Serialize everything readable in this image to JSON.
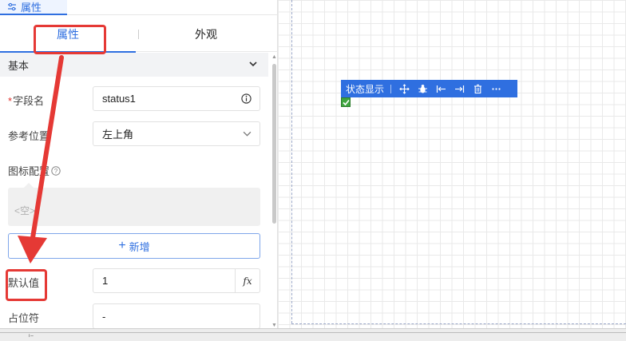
{
  "panel": {
    "tab_label": "属性",
    "tab_icon": "sliders-icon",
    "subtabs": {
      "active": "属性",
      "other": "外观"
    },
    "group": {
      "title": "基本",
      "icon": "chevron-down-icon"
    },
    "fields": {
      "field_name": {
        "required_mark": "*",
        "label": "字段名",
        "value": "status1",
        "icon": "info-icon"
      },
      "ref_position": {
        "label": "参考位置",
        "value": "左上角",
        "icon": "chevron-down-icon"
      },
      "icon_config": {
        "label": "图标配置",
        "icon": "help-circle-icon",
        "empty_text": "<空>"
      },
      "add_button": {
        "label": "新增",
        "icon": "plus-icon"
      },
      "default_value": {
        "label": "默认值",
        "value": "1",
        "fx_label": "fx"
      },
      "placeholder": {
        "label": "占位符",
        "value": "-"
      }
    }
  },
  "canvas": {
    "toolbar": {
      "title": "状态显示",
      "icons": [
        "move-icon",
        "bug-icon",
        "align-left-icon",
        "align-right-icon",
        "trash-icon",
        "more-icon"
      ]
    },
    "checkbox": {
      "checked": true,
      "color": "#3fa53f"
    }
  },
  "statusbar": {
    "text": "ⁱ⁻"
  },
  "colors": {
    "accent": "#2f6fe0",
    "annotation": "#e53935"
  }
}
